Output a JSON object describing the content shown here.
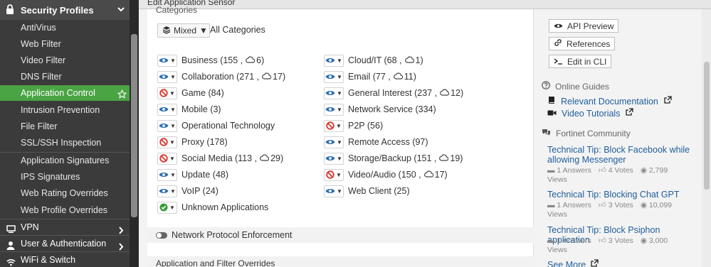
{
  "window": {
    "title": "Edit Application Sensor"
  },
  "sidebar": {
    "header": "Security Profiles",
    "items": [
      {
        "label": "AntiVirus"
      },
      {
        "label": "Web Filter"
      },
      {
        "label": "Video Filter"
      },
      {
        "label": "DNS Filter"
      },
      {
        "label": "Application Control",
        "active": true
      },
      {
        "label": "Intrusion Prevention"
      },
      {
        "label": "File Filter"
      },
      {
        "label": "SSL/SSH Inspection"
      },
      {
        "label": "Application Signatures"
      },
      {
        "label": "IPS Signatures"
      },
      {
        "label": "Web Rating Overrides"
      },
      {
        "label": "Web Profile Overrides"
      }
    ],
    "groups": [
      {
        "label": "VPN",
        "icon": "monitor-icon"
      },
      {
        "label": "User & Authentication",
        "icon": "user-icon"
      },
      {
        "label": "WiFi & Switch",
        "icon": "wifi-icon"
      }
    ]
  },
  "main": {
    "categories_label": "Categories",
    "mixed_label": "Mixed",
    "all_categories_label": "All Categories",
    "categories_left": [
      {
        "name": "Business (155 ,",
        "cloud": "6)",
        "action": "monitor"
      },
      {
        "name": "Collaboration (271 ,",
        "cloud": "17)",
        "action": "monitor"
      },
      {
        "name": "Game (84)",
        "action": "block"
      },
      {
        "name": "Mobile (3)",
        "action": "monitor"
      },
      {
        "name": "Operational Technology",
        "action": "monitor"
      },
      {
        "name": "Proxy (178)",
        "action": "block"
      },
      {
        "name": "Social Media (113 ,",
        "cloud": "29)",
        "action": "block"
      },
      {
        "name": "Update (48)",
        "action": "monitor"
      },
      {
        "name": "VoIP (24)",
        "action": "monitor"
      },
      {
        "name": "Unknown Applications",
        "action": "allow"
      }
    ],
    "categories_right": [
      {
        "name": "Cloud/IT (68 ,",
        "cloud": "1)",
        "action": "monitor"
      },
      {
        "name": "Email (77 ,",
        "cloud": "11)",
        "action": "monitor"
      },
      {
        "name": "General Interest (237 ,",
        "cloud": "12)",
        "action": "monitor"
      },
      {
        "name": "Network Service (334)",
        "action": "monitor"
      },
      {
        "name": "P2P (56)",
        "action": "block"
      },
      {
        "name": "Remote Access (97)",
        "action": "monitor"
      },
      {
        "name": "Storage/Backup (151 ,",
        "cloud": "19)",
        "action": "monitor"
      },
      {
        "name": "Video/Audio (150 ,",
        "cloud": "17)",
        "action": "block"
      },
      {
        "name": "Web Client (25)",
        "action": "monitor"
      }
    ],
    "network_protocol_enforcement": "Network Protocol Enforcement",
    "overrides_label": "Application and Filter Overrides"
  },
  "right": {
    "api_preview": "API Preview",
    "references": "References",
    "edit_in_cli": "Edit in CLI",
    "online_guides": "Online Guides",
    "relevant_documentation": "Relevant Documentation",
    "video_tutorials": "Video Tutorials",
    "fortinet_community": "Fortinet Community",
    "tips": [
      {
        "title": "Technical Tip: Block Facebook while allowing Messenger",
        "answers": "1 Answers",
        "votes": "4 Votes",
        "views_count": "2,799",
        "views_label": "Views"
      },
      {
        "title": "Technical Tip: Blocking Chat GPT",
        "answers": "1 Answers",
        "votes": "3 Votes",
        "views_count": "10,099",
        "views_label": "Views"
      },
      {
        "title": "Technical Tip: Block Psiphon application",
        "answers": "1 Answers",
        "votes": "3 Votes",
        "views_count": "3,000",
        "views_label": "Views"
      }
    ],
    "see_more": "See More"
  },
  "colors": {
    "active_green": "#4aa444",
    "link_blue": "#1f5e9c",
    "block_red": "#d9362b",
    "monitor_blue": "#2d6fb3",
    "allow_green": "#3a9a3a"
  }
}
